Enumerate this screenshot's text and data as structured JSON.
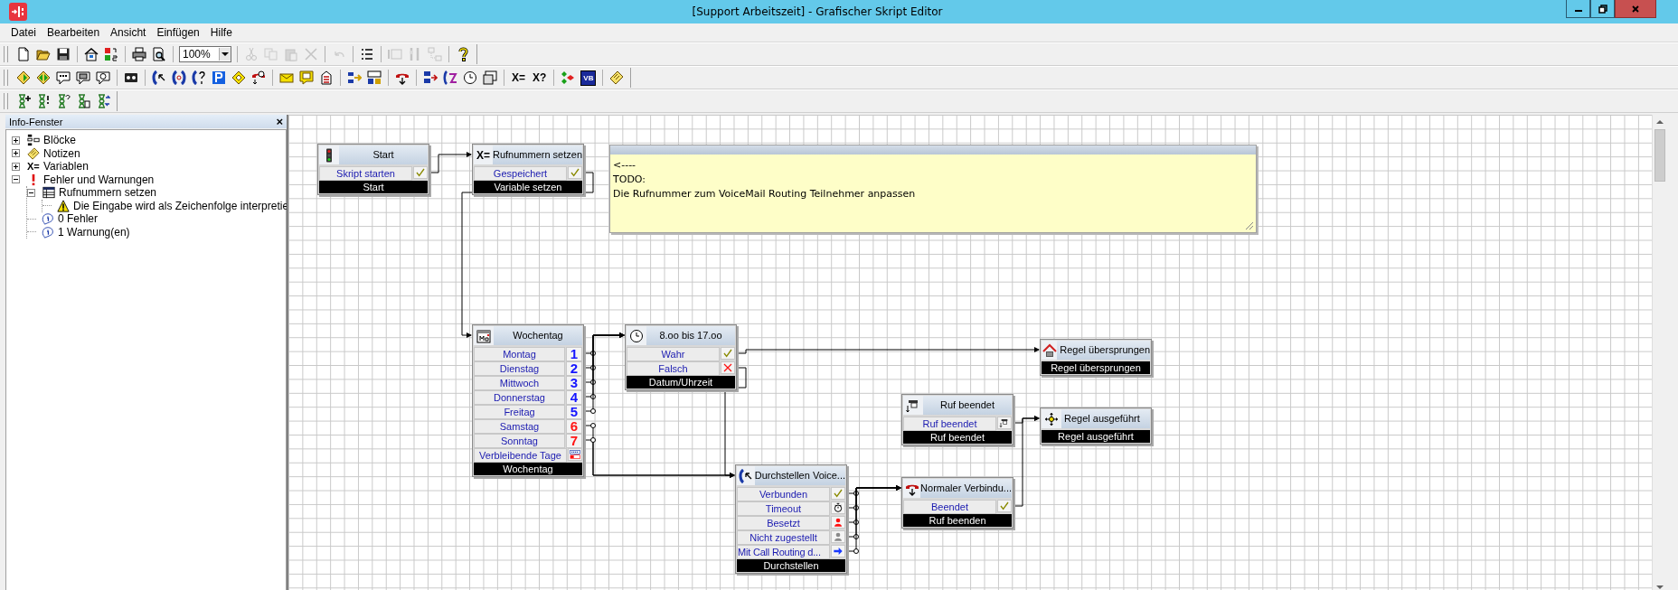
{
  "window": {
    "title": "[Support Arbeitszeit] - Grafischer Skript Editor"
  },
  "menu": [
    "Datei",
    "Bearbeiten",
    "Ansicht",
    "Einfügen",
    "Hilfe"
  ],
  "toolbars": [
    [
      [
        {
          "kind": "new",
          "disabled": false
        },
        {
          "kind": "open",
          "disabled": false
        },
        {
          "kind": "save",
          "disabled": false
        }
      ],
      [
        {
          "kind": "properties",
          "disabled": false
        },
        {
          "kind": "numbering",
          "disabled": false
        }
      ],
      [
        {
          "kind": "print",
          "disabled": false
        },
        {
          "kind": "preview",
          "disabled": false
        }
      ],
      [
        {
          "kind": "zoom",
          "value": "100%",
          "disabled": false
        }
      ],
      [
        {
          "kind": "cut",
          "disabled": true
        },
        {
          "kind": "copy",
          "disabled": true
        },
        {
          "kind": "paste",
          "disabled": true
        },
        {
          "kind": "delete",
          "disabled": true
        }
      ],
      [
        {
          "kind": "undo",
          "disabled": true
        }
      ],
      [
        {
          "kind": "list",
          "disabled": false
        }
      ],
      [
        {
          "kind": "panel",
          "disabled": true
        },
        {
          "kind": "tools",
          "disabled": true
        },
        {
          "kind": "layout",
          "disabled": true
        }
      ],
      [
        {
          "kind": "help",
          "disabled": false
        }
      ]
    ],
    [
      [
        {
          "kind": "diamond_right",
          "disabled": false
        },
        {
          "kind": "diamond_both",
          "disabled": false
        },
        {
          "kind": "bubble_numbers",
          "disabled": false
        },
        {
          "kind": "bubble_screen",
          "disabled": false
        },
        {
          "kind": "bubble_clock",
          "disabled": false
        }
      ],
      [
        {
          "kind": "tape",
          "disabled": false
        }
      ],
      [
        {
          "kind": "call_transfer",
          "disabled": false
        },
        {
          "kind": "call_hold",
          "disabled": false
        },
        {
          "kind": "call_question",
          "disabled": false
        },
        {
          "kind": "parking",
          "disabled": false
        },
        {
          "kind": "diamond_yellow",
          "disabled": false
        },
        {
          "kind": "hangup_timer",
          "disabled": false
        }
      ],
      [
        {
          "kind": "mail",
          "disabled": false
        },
        {
          "kind": "voicemail",
          "disabled": false
        },
        {
          "kind": "stack",
          "disabled": false
        }
      ],
      [
        {
          "kind": "blocks_arrow",
          "disabled": false
        },
        {
          "kind": "blocks_number",
          "disabled": false
        }
      ],
      [
        {
          "kind": "phone_down",
          "disabled": false
        }
      ],
      [
        {
          "kind": "routing",
          "disabled": false
        },
        {
          "kind": "calendar",
          "disabled": false
        },
        {
          "kind": "clock",
          "disabled": false
        },
        {
          "kind": "window",
          "disabled": false
        }
      ],
      [
        {
          "kind": "text",
          "label": "X=",
          "disabled": false
        },
        {
          "kind": "text",
          "label": "X?",
          "disabled": false
        }
      ],
      [
        {
          "kind": "flow",
          "disabled": false
        },
        {
          "kind": "vb",
          "label": "VB",
          "disabled": false
        }
      ],
      [
        {
          "kind": "note",
          "disabled": false
        }
      ]
    ],
    [
      [
        {
          "kind": "hourglass_add",
          "disabled": false
        },
        {
          "kind": "hourglass_warn",
          "disabled": false
        },
        {
          "kind": "hourglass_query",
          "disabled": false
        },
        {
          "kind": "hourglass_delete",
          "disabled": false
        },
        {
          "kind": "hourglass_swap",
          "disabled": false
        }
      ]
    ]
  ],
  "info_panel": {
    "title": "Info-Fenster",
    "close": "×",
    "tree": [
      {
        "kind": "blocks",
        "label": "Blöcke",
        "expanded": false
      },
      {
        "kind": "notes",
        "label": "Notizen",
        "expanded": false
      },
      {
        "kind": "variables",
        "glyph": "X=",
        "label": "Variablen",
        "expanded": false
      },
      {
        "kind": "errors",
        "label": "Fehler und Warnungen",
        "expanded": true,
        "children": [
          {
            "kind": "block",
            "label": "Rufnummern setzen",
            "expanded": true,
            "children": [
              {
                "kind": "warning",
                "label": "Die Eingabe wird als Zeichenfolge interpretie"
              }
            ]
          },
          {
            "kind": "info",
            "label": "0 Fehler"
          },
          {
            "kind": "info",
            "label": "1 Warnung(en)"
          }
        ]
      }
    ]
  },
  "note": {
    "lines": [
      "<----",
      "TODO:",
      "Die Rufnummer zum VoiceMail Routing Teilnehmer anpassen"
    ]
  },
  "blocks": [
    {
      "kind": "start",
      "title": "Start",
      "rows": [
        {
          "label": "Skript starten",
          "kind": "check"
        }
      ],
      "footer": "Start"
    },
    {
      "kind": "variable",
      "glyph": "X=",
      "title": "Rufnummern setzen",
      "rows": [
        {
          "label": "Gespeichert",
          "kind": "check"
        }
      ],
      "footer": "Variable setzen"
    },
    {
      "kind": "weekday",
      "title": "Wochentag",
      "rows": [
        {
          "label": "Montag",
          "kind": "digit",
          "digit": "1",
          "color": "#1414ff"
        },
        {
          "label": "Dienstag",
          "kind": "digit",
          "digit": "2",
          "color": "#1414ff"
        },
        {
          "label": "Mittwoch",
          "kind": "digit",
          "digit": "3",
          "color": "#1414ff"
        },
        {
          "label": "Donnerstag",
          "kind": "digit",
          "digit": "4",
          "color": "#1414ff"
        },
        {
          "label": "Freitag",
          "kind": "digit",
          "digit": "5",
          "color": "#1414ff"
        },
        {
          "label": "Samstag",
          "kind": "digit",
          "digit": "6",
          "color": "#ff1414"
        },
        {
          "label": "Sonntag",
          "kind": "digit",
          "digit": "7",
          "color": "#ff1414"
        },
        {
          "label": "Verbleibende Tage",
          "kind": "remaining"
        }
      ],
      "footer": "Wochentag"
    },
    {
      "kind": "clock",
      "title": "8.oo bis 17.oo",
      "rows": [
        {
          "label": "Wahr",
          "kind": "check"
        },
        {
          "label": "Falsch",
          "kind": "cross"
        }
      ],
      "footer": "Datum/Uhrzeit"
    },
    {
      "kind": "skip",
      "title": "Regel übersprungen",
      "footer": "Regel übersprungen"
    },
    {
      "kind": "hangup_event",
      "title": "Ruf beendet",
      "rows": [
        {
          "label": "Ruf beendet",
          "kind": "hangup_event"
        }
      ],
      "footer": "Ruf beendet"
    },
    {
      "kind": "done",
      "title": "Regel ausgeführt",
      "footer": "Regel ausgeführt"
    },
    {
      "kind": "transfer",
      "title": "Durchstellen Voice...",
      "rows": [
        {
          "label": "Verbunden",
          "kind": "check"
        },
        {
          "label": "Timeout",
          "kind": "timer"
        },
        {
          "label": "Besetzt",
          "kind": "busy"
        },
        {
          "label": "Nicht zugestellt",
          "kind": "absent"
        },
        {
          "label": "Mit Call Routing d...",
          "kind": "redirect"
        }
      ],
      "footer": "Durchstellen"
    },
    {
      "kind": "hangup",
      "title": "Normaler Verbindu...",
      "rows": [
        {
          "label": "Beendet",
          "kind": "check"
        }
      ],
      "footer": "Ruf beenden"
    }
  ]
}
